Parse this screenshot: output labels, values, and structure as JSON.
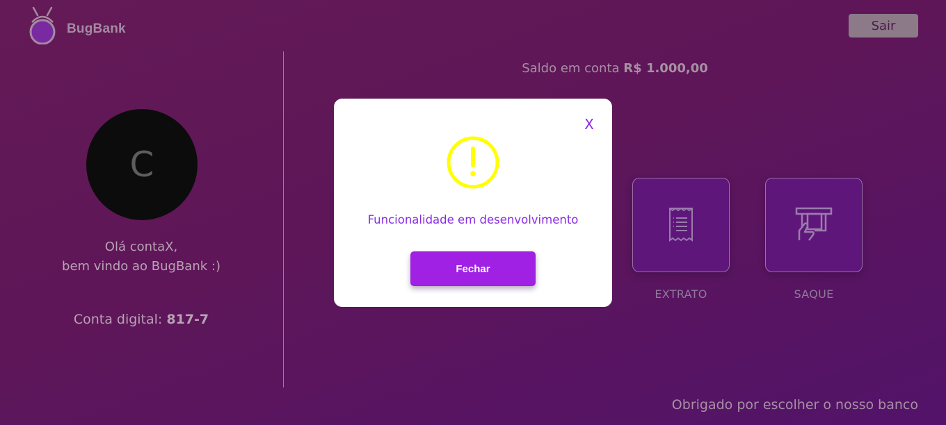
{
  "header": {
    "brand": "BugBank",
    "logout_label": "Sair",
    "logo_icon": "bug-icon"
  },
  "profile": {
    "avatar_letter": "C",
    "greeting_line1": "Olá contaX,",
    "greeting_line2": "bem vindo ao BugBank :)",
    "account_label": "Conta digital:",
    "account_number": "817-7"
  },
  "balance": {
    "label": "Saldo em conta",
    "value": "R$ 1.000,00"
  },
  "actions": [
    {
      "label": "EXTRATO",
      "icon": "receipt-icon"
    },
    {
      "label": "SAQUE",
      "icon": "atm-withdraw-icon"
    }
  ],
  "footer": {
    "text": "Obrigado por escolher o nosso banco"
  },
  "modal": {
    "close_label": "X",
    "icon": "warning-icon",
    "message": "Funcionalidade em desenvolvimento",
    "button_label": "Fechar"
  },
  "colors": {
    "accent": "#8a2be2",
    "button": "#a020e4",
    "warning": "#ffff00",
    "background": "#5e1658"
  }
}
